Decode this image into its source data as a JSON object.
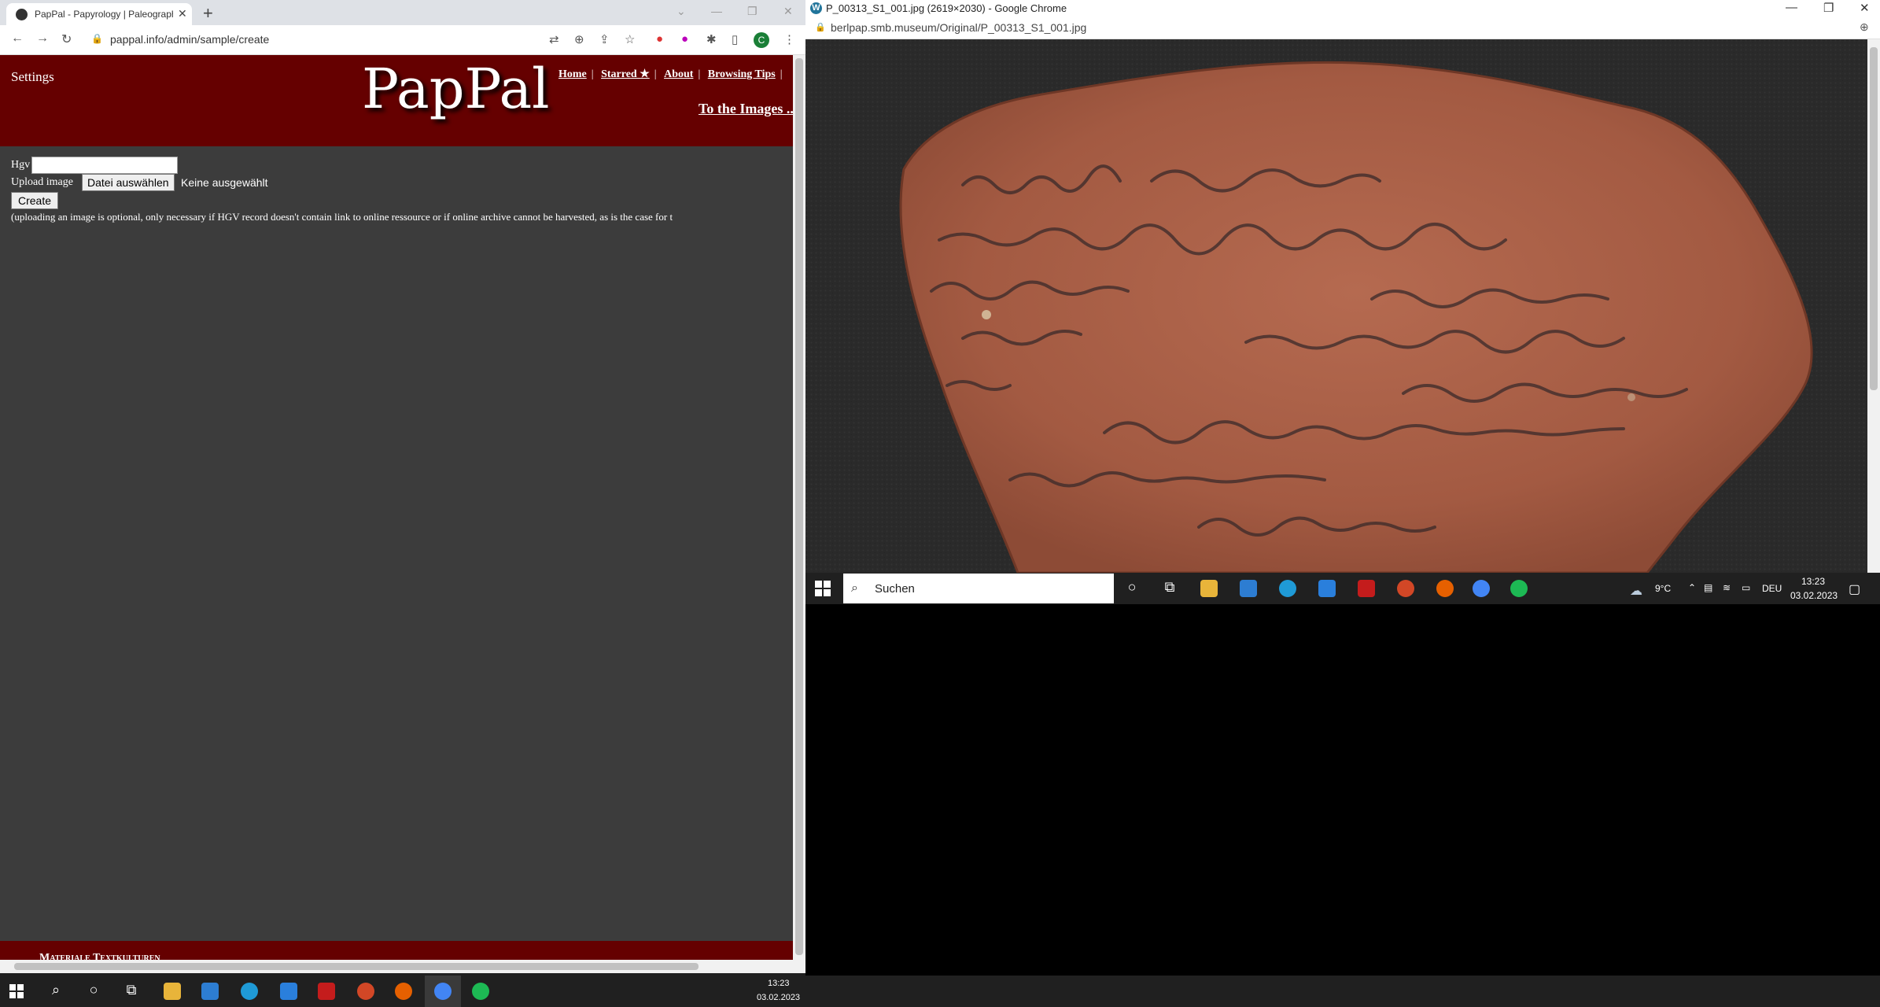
{
  "left_window": {
    "tab_title": "PapPal - Papyrology | Paleograph",
    "url": "pappal.info/admin/sample/create",
    "profile_initial": "C",
    "site": {
      "settings": "Settings",
      "logo": "PapPal",
      "nav": [
        "Home",
        "Starred ★",
        "About",
        "Browsing Tips"
      ],
      "to_images": "To the Images ...",
      "hgv_label": "Hgv",
      "hgv_value": "",
      "upload_label": "Upload image",
      "file_button": "Datei auswählen",
      "file_status": "Keine ausgewählt",
      "create_button": "Create",
      "note": "(uploading an image is optional, only necessary if HGV record doesn't contain link to online ressource or if online archive cannot be harvested, as is the case for t",
      "footer": "Materiale Textkulturen"
    }
  },
  "right_window": {
    "title": "P_00313_S1_001.jpg (2619×2030) - Google Chrome",
    "url": "berlpap.smb.museum/Original/P_00313_S1_001.jpg"
  },
  "inner_taskbar": {
    "search_placeholder": "Suchen",
    "weather": "9°C",
    "language": "DEU",
    "time": "13:23",
    "date": "03.02.2023"
  },
  "main_taskbar": {
    "time": "13:23",
    "date": "03.02.2023"
  }
}
